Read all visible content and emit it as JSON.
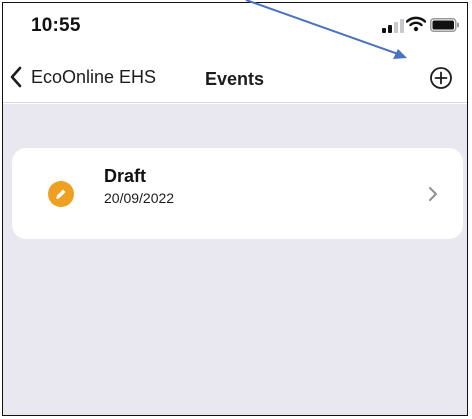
{
  "status_bar": {
    "time": "10:55",
    "icons": [
      "cellular-signal-icon",
      "wifi-icon",
      "battery-icon"
    ]
  },
  "nav": {
    "back_label": "EcoOnline EHS",
    "title": "Events",
    "add_icon": "plus-circle-icon"
  },
  "events": [
    {
      "title": "Draft",
      "date": "20/09/2022",
      "icon": "pencil-icon",
      "icon_color": "#f0a020"
    }
  ],
  "colors": {
    "background": "#e9e8f0",
    "card": "#ffffff",
    "annotation_arrow": "#4a72c0",
    "draft_accent": "#f0a020"
  }
}
